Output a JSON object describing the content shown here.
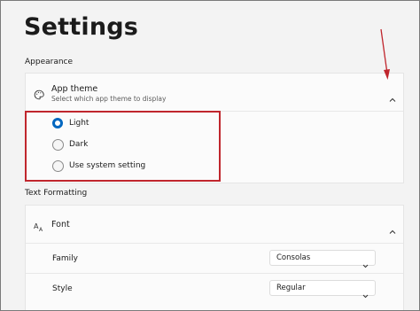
{
  "page": {
    "title": "Settings"
  },
  "appearance": {
    "section_label": "Appearance",
    "app_theme": {
      "title": "App theme",
      "subtitle": "Select which app theme to display",
      "icon": "palette-icon",
      "expanded": true,
      "options": [
        {
          "label": "Light",
          "selected": true
        },
        {
          "label": "Dark",
          "selected": false
        },
        {
          "label": "Use system setting",
          "selected": false
        }
      ]
    }
  },
  "text_formatting": {
    "section_label": "Text Formatting",
    "font": {
      "title": "Font",
      "icon": "font-size-icon",
      "expanded": true,
      "family": {
        "label": "Family",
        "value": "Consolas"
      },
      "style": {
        "label": "Style",
        "value": "Regular"
      }
    }
  },
  "colors": {
    "accent": "#0067c0",
    "highlight_box": "#c0262d",
    "annotation_arrow": "#c0262d"
  }
}
